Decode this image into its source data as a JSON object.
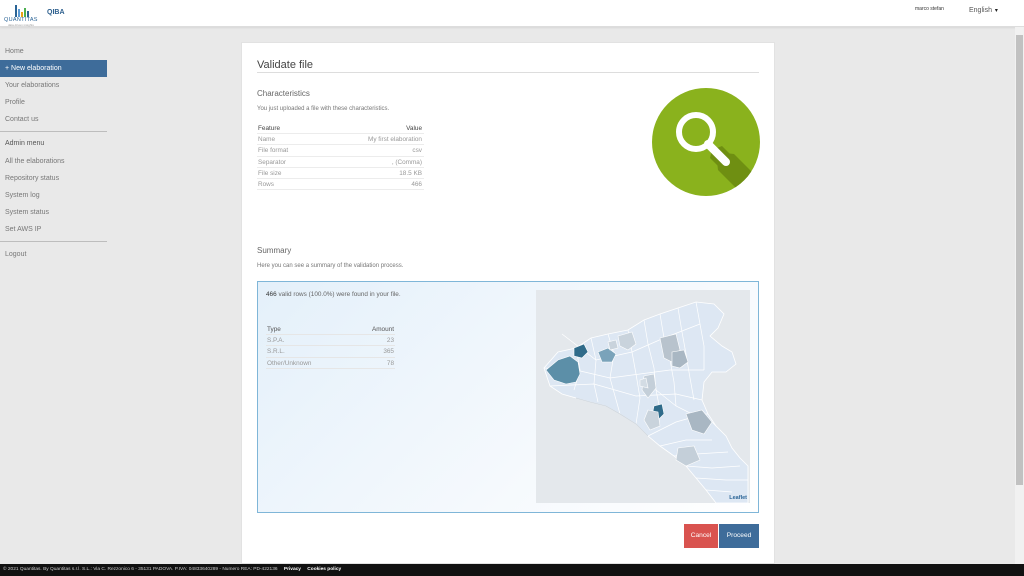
{
  "header": {
    "logo_text": "QUANTITAS",
    "logo_tagline": "data driven insights",
    "app_name": "QIBA",
    "user": "marco stefan",
    "language": "English",
    "language_icon": "chevron-down-icon"
  },
  "sidebar": {
    "items": [
      {
        "label": "Home"
      },
      {
        "label": "+ New elaboration"
      },
      {
        "label": "Your elaborations"
      },
      {
        "label": "Profile"
      },
      {
        "label": "Contact us"
      }
    ],
    "admin_header": "Admin menu",
    "admin_items": [
      {
        "label": "All the elaborations"
      },
      {
        "label": "Repository status"
      },
      {
        "label": "System log"
      },
      {
        "label": "System status"
      },
      {
        "label": "Set AWS IP"
      }
    ],
    "logout": "Logout"
  },
  "main": {
    "title": "Validate file",
    "characteristics": {
      "title": "Characteristics",
      "description": "You just uploaded a file with these characteristics.",
      "header": {
        "feature": "Feature",
        "value": "Value"
      },
      "rows": [
        {
          "feature": "Name",
          "value": "My first elaboration"
        },
        {
          "feature": "File format",
          "value": "csv"
        },
        {
          "feature": "Separator",
          "value": ", (Comma)"
        },
        {
          "feature": "File size",
          "value": "18.5 KB"
        },
        {
          "feature": "Rows",
          "value": "466"
        }
      ]
    },
    "illustration_icon": "magnifier-icon",
    "summary": {
      "title": "Summary",
      "description": "Here you can see a summary of the validation process.",
      "valid_count": "466",
      "valid_text": " valid rows (100.0%) were found in your file.",
      "header": {
        "type": "Type",
        "amount": "Amount"
      },
      "rows": [
        {
          "type": "S.P.A.",
          "amount": "23"
        },
        {
          "type": "S.R.L.",
          "amount": "365"
        },
        {
          "type": "Other/Unknown",
          "amount": "78"
        }
      ],
      "map_attribution": "Leaflet"
    },
    "buttons": {
      "cancel": "Cancel",
      "proceed": "Proceed"
    }
  },
  "footer": {
    "text": "© 2021 Quantitas. By Quantitas s.r.l. S.L.: Via C. Rezzonico 6 - 35131 PADOVA. P.IVA: 04833640289 - Numero REA: PD-422136",
    "privacy": "Privacy",
    "cookies": "Cookies policy"
  },
  "colors": {
    "accent": "#3e6c9a",
    "danger": "#d9534f",
    "magnifier_green": "#8ab21d",
    "map_dark": "#2f6b8a",
    "map_light": "#dde7f3"
  }
}
